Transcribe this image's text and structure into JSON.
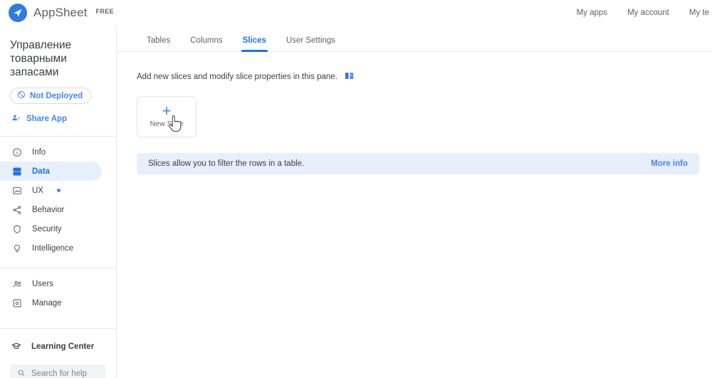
{
  "brand": {
    "name": "AppSheet",
    "plan": "FREE",
    "logo_icon": "paper-plane-icon",
    "logo_color": "#2f7ae5"
  },
  "topnav": {
    "items": [
      {
        "label": "My apps",
        "name": "my-apps-link"
      },
      {
        "label": "My account",
        "name": "my-account-link"
      },
      {
        "label": "My te",
        "name": "my-team-link"
      }
    ]
  },
  "sidebar": {
    "app_title": "Управление товарными запасами",
    "deploy_badge": {
      "label": "Not Deployed",
      "icon": "block-icon"
    },
    "share": {
      "label": "Share App",
      "icon": "person-add-icon"
    },
    "nav_primary": [
      {
        "label": "Info",
        "icon": "info-circle-icon",
        "active": false,
        "badge": false
      },
      {
        "label": "Data",
        "icon": "database-icon",
        "active": true,
        "badge": false
      },
      {
        "label": "UX",
        "icon": "screen-icon",
        "active": false,
        "badge": true
      },
      {
        "label": "Behavior",
        "icon": "share-nodes-icon",
        "active": false,
        "badge": false
      },
      {
        "label": "Security",
        "icon": "shield-icon",
        "active": false,
        "badge": false
      },
      {
        "label": "Intelligence",
        "icon": "lightbulb-icon",
        "active": false,
        "badge": false
      }
    ],
    "nav_secondary": [
      {
        "label": "Users",
        "icon": "users-icon"
      },
      {
        "label": "Manage",
        "icon": "manage-icon"
      }
    ],
    "learning": {
      "label": "Learning Center",
      "icon": "graduation-cap-icon"
    },
    "help_search": {
      "placeholder": "Search for help",
      "value": "",
      "icon": "search-icon"
    }
  },
  "main": {
    "tabs": [
      {
        "label": "Tables",
        "active": false
      },
      {
        "label": "Columns",
        "active": false
      },
      {
        "label": "Slices",
        "active": true
      },
      {
        "label": "User Settings",
        "active": false
      }
    ],
    "description": "Add new slices and modify slice properties in this pane.",
    "description_icon": "book-icon",
    "new_slice_card": {
      "label": "New Slice",
      "plus": "+"
    },
    "banner": {
      "text": "Slices allow you to filter the rows in a table.",
      "link": "More info"
    }
  },
  "colors": {
    "accent": "#4285f4",
    "accent_dark": "#1a73e8",
    "active_nav_bg": "#e8f0fe",
    "banner_bg": "#e9eefb",
    "text": "#3c4043",
    "muted": "#5f6368"
  }
}
